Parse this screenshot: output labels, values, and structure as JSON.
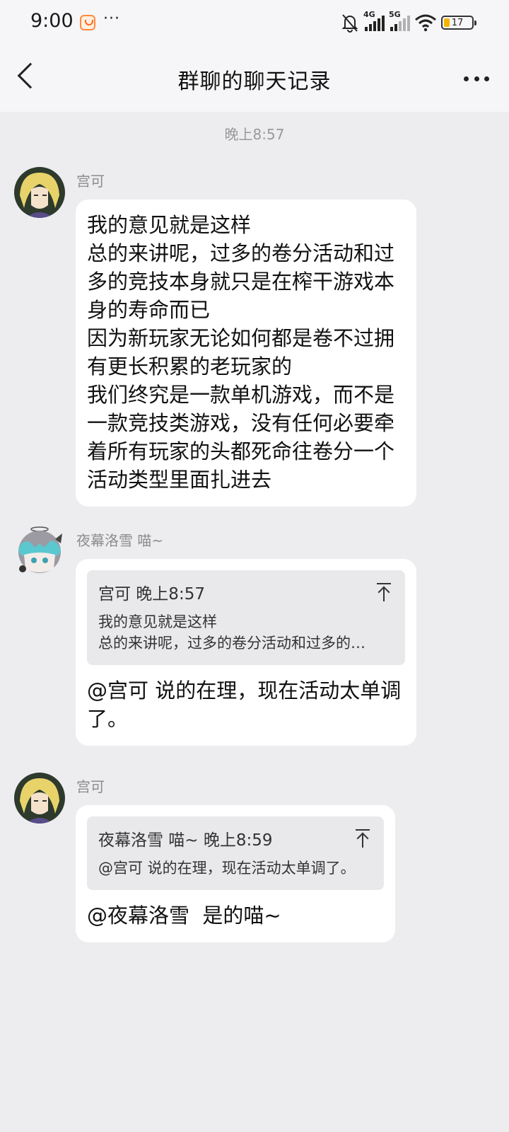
{
  "status_bar": {
    "time": "9:00",
    "more": "···",
    "net1": "4G",
    "net2": "5G",
    "battery": "17"
  },
  "header": {
    "title": "群聊的聊天记录"
  },
  "timestamp": "晚上8:57",
  "messages": [
    {
      "sender": "宫可",
      "avatar": "blonde-anime-avatar",
      "text": "我的意见就是这样\n总的来讲呢，过多的卷分活动和过多的竞技本身就只是在榨干游戏本身的寿命而已\n因为新玩家无论如何都是卷不过拥有更长积累的老玩家的\n我们终究是一款单机游戏，而不是一款竞技类游戏，没有任何必要牵着所有玩家的头都死命往卷分一个活动类型里面扎进去"
    },
    {
      "sender": "夜幕洛雪 喵~",
      "avatar": "teal-hair-chibi-avatar",
      "quote": {
        "header": "宫可  晚上8:57",
        "body": "我的意见就是这样\n总的来讲呢，过多的卷分活动和过多的…"
      },
      "text": "@宫可 说的在理，现在活动太单调了。"
    },
    {
      "sender": "宫可",
      "avatar": "blonde-anime-avatar",
      "quote": {
        "header": "夜幕洛雪 喵~  晚上8:59",
        "body": "@宫可 说的在理，现在活动太单调了。"
      },
      "text": "@夜幕洛雪  是的喵~"
    }
  ],
  "colors": {
    "background": "#ededf0",
    "bubble": "#ffffff",
    "quote": "#e9e9ec",
    "meta_text": "#999999"
  }
}
